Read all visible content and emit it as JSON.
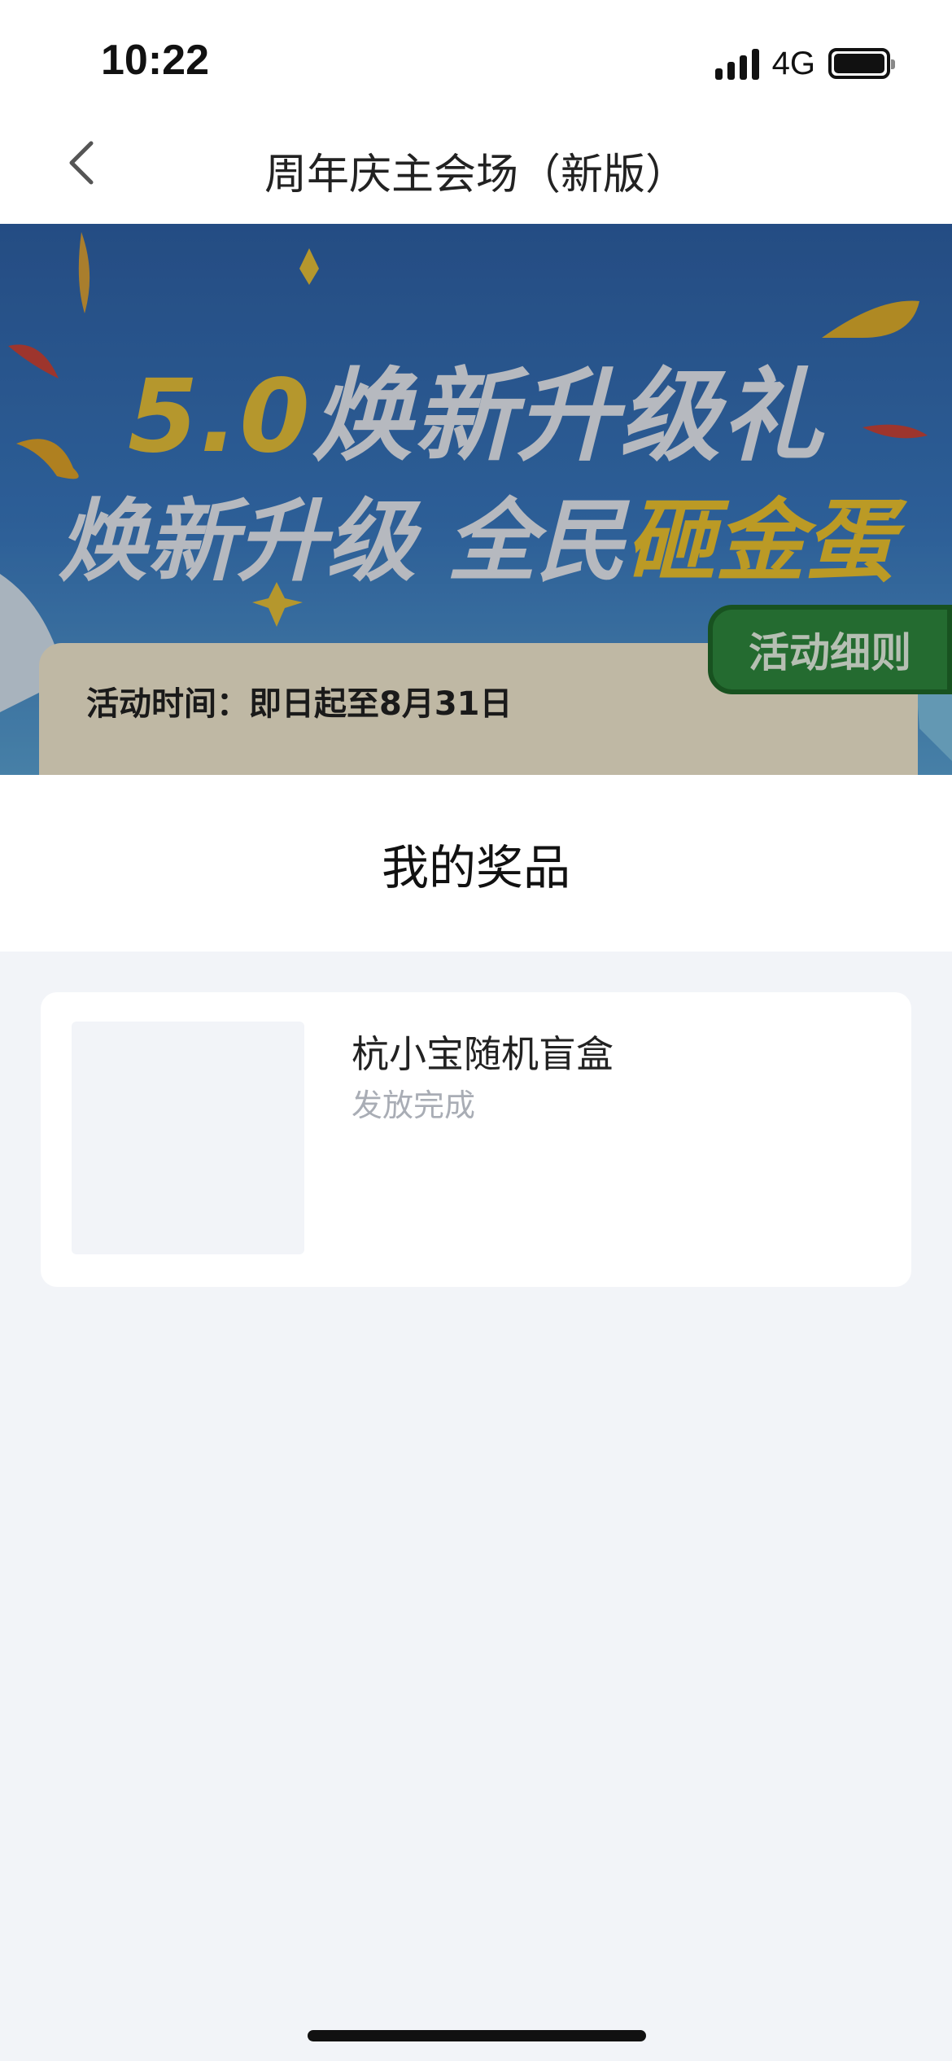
{
  "status_bar": {
    "time": "10:22",
    "network": "4G"
  },
  "nav": {
    "title": "周年庆主会场（新版）",
    "back_icon": "chevron-left-icon"
  },
  "banner": {
    "line1_highlight": "5.0",
    "line1_rest": "焕新升级礼",
    "line2_plain": "焕新升级 全民",
    "line2_highlight": "砸金蛋",
    "activity_time": "活动时间：即日起至8月31日",
    "rules_label": "活动细则"
  },
  "sheet": {
    "title": "我的奖品",
    "prizes": [
      {
        "name": "杭小宝随机盲盒",
        "status": "发放完成"
      }
    ]
  },
  "colors": {
    "banner_blue": "#2f62a8",
    "highlight_gold": "#e8c23a",
    "rules_green": "#2f8a3e",
    "status_grey": "#a9adb5",
    "sheet_bg": "#f2f4f8"
  }
}
